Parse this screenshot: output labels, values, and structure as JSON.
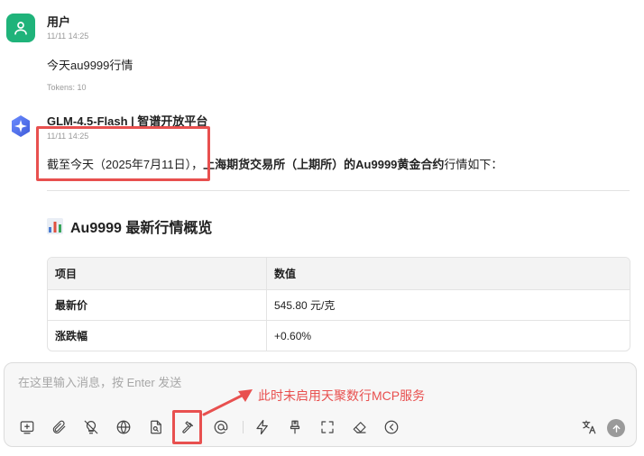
{
  "user_message": {
    "name": "用户",
    "time": "11/11 14:25",
    "text": "今天au9999行情",
    "tokens": "Tokens: 10"
  },
  "ai_message": {
    "name": "GLM-4.5-Flash | 智谱开放平台",
    "time": "11/11 14:25",
    "intro_prefix": "截至今天（2025年7月11日），",
    "intro_bold": "上海期货交易所（上期所）的Au9999黄金合约",
    "intro_suffix": "行情如下：",
    "section_title": "Au9999 最新行情概览",
    "table": {
      "headers": [
        "项目",
        "数值"
      ],
      "rows": [
        [
          "最新价",
          "545.80 元/克"
        ],
        [
          "涨跌幅",
          "+0.60%"
        ]
      ]
    }
  },
  "composer": {
    "placeholder": "在这里输入消息，按 Enter 发送"
  },
  "annotation": {
    "text": "此时未启用天聚数行MCP服务",
    "color": "#e8504f"
  },
  "colors": {
    "user_avatar": "#1fb37a",
    "highlight": "#e8504f"
  },
  "icons": {
    "user_avatar": "person-icon",
    "ai_avatar": "sparkle-logo-icon",
    "toolbar": [
      "new-topic-icon",
      "attachment-icon",
      "lightbulb-off-icon",
      "globe-icon",
      "file-search-icon",
      "hammer-icon",
      "at-icon",
      "lightning-icon",
      "brush-icon",
      "fullscreen-icon",
      "eraser-icon",
      "chevron-left-circle-icon",
      "translate-icon",
      "send-icon"
    ]
  }
}
